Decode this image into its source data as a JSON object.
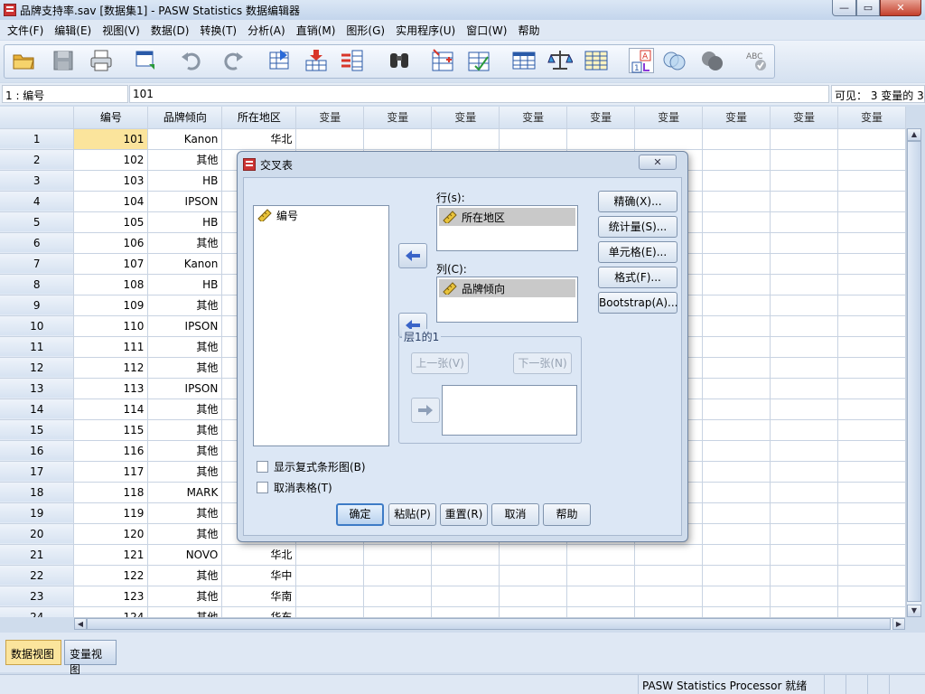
{
  "window": {
    "title": "品牌支持率.sav [数据集1] - PASW Statistics 数据编辑器",
    "min": "—",
    "max": "▭",
    "close": "✕"
  },
  "menu": [
    "文件(F)",
    "编辑(E)",
    "视图(V)",
    "数据(D)",
    "转换(T)",
    "分析(A)",
    "直销(M)",
    "图形(G)",
    "实用程序(U)",
    "窗口(W)",
    "帮助"
  ],
  "toolbar": {
    "icons": [
      "open-folder-icon",
      "save-icon",
      "print-icon",
      "dialog-recall-icon",
      "undo-icon",
      "redo-icon",
      "goto-case-icon",
      "goto-variable-icon",
      "variables-icon",
      "find-icon",
      "insert-cases-icon",
      "insert-variable-icon",
      "split-file-icon",
      "weight-cases-icon",
      "select-cases-icon",
      "value-labels-icon",
      "use-sets-icon",
      "show-all-variables-icon",
      "spell-check-icon"
    ]
  },
  "cell_editor": {
    "ref": "1 : 编号",
    "value": "101",
    "visible": "可见：  3 变量的 3"
  },
  "grid": {
    "columns": [
      "编号",
      "品牌倾向",
      "所在地区",
      "变量",
      "变量",
      "变量",
      "变量",
      "变量",
      "变量",
      "变量",
      "变量",
      "变量"
    ],
    "rows": [
      {
        "n": "1",
        "id": "101",
        "brand": "Kanon",
        "region": "华北"
      },
      {
        "n": "2",
        "id": "102",
        "brand": "其他",
        "region": ""
      },
      {
        "n": "3",
        "id": "103",
        "brand": "HB",
        "region": ""
      },
      {
        "n": "4",
        "id": "104",
        "brand": "IPSON",
        "region": ""
      },
      {
        "n": "5",
        "id": "105",
        "brand": "HB",
        "region": ""
      },
      {
        "n": "6",
        "id": "106",
        "brand": "其他",
        "region": ""
      },
      {
        "n": "7",
        "id": "107",
        "brand": "Kanon",
        "region": ""
      },
      {
        "n": "8",
        "id": "108",
        "brand": "HB",
        "region": ""
      },
      {
        "n": "9",
        "id": "109",
        "brand": "其他",
        "region": ""
      },
      {
        "n": "10",
        "id": "110",
        "brand": "IPSON",
        "region": ""
      },
      {
        "n": "11",
        "id": "111",
        "brand": "其他",
        "region": ""
      },
      {
        "n": "12",
        "id": "112",
        "brand": "其他",
        "region": ""
      },
      {
        "n": "13",
        "id": "113",
        "brand": "IPSON",
        "region": ""
      },
      {
        "n": "14",
        "id": "114",
        "brand": "其他",
        "region": ""
      },
      {
        "n": "15",
        "id": "115",
        "brand": "其他",
        "region": ""
      },
      {
        "n": "16",
        "id": "116",
        "brand": "其他",
        "region": ""
      },
      {
        "n": "17",
        "id": "117",
        "brand": "其他",
        "region": ""
      },
      {
        "n": "18",
        "id": "118",
        "brand": "MARK",
        "region": ""
      },
      {
        "n": "19",
        "id": "119",
        "brand": "其他",
        "region": ""
      },
      {
        "n": "20",
        "id": "120",
        "brand": "其他",
        "region": ""
      },
      {
        "n": "21",
        "id": "121",
        "brand": "NOVO",
        "region": "华北"
      },
      {
        "n": "22",
        "id": "122",
        "brand": "其他",
        "region": "华中"
      },
      {
        "n": "23",
        "id": "123",
        "brand": "其他",
        "region": "华南"
      },
      {
        "n": "24",
        "id": "124",
        "brand": "其他",
        "region": "华东"
      }
    ]
  },
  "tabs": {
    "data_view": "数据视图",
    "variable_view": "变量视图"
  },
  "status": {
    "text": "PASW Statistics Processor 就绪"
  },
  "dialog": {
    "title": "交叉表",
    "close": "✕",
    "source_list": [
      "编号"
    ],
    "row_label": "行(s):",
    "row_items": [
      "所在地区"
    ],
    "col_label": "列(C):",
    "col_items": [
      "品牌倾向"
    ],
    "layer_label": "层1的1",
    "prev_layer": "上一张(V)",
    "next_layer": "下一张(N)",
    "side_buttons": [
      "精确(X)...",
      "统计量(S)...",
      "单元格(E)...",
      "格式(F)...",
      "Bootstrap(A)..."
    ],
    "checkboxes": [
      "显示复式条形图(B)",
      "取消表格(T)"
    ],
    "bottom_buttons": [
      "确定",
      "粘贴(P)",
      "重置(R)",
      "取消",
      "帮助"
    ]
  },
  "colors": {
    "selected_cell": "#fbe49c",
    "active_tab": "#fbe49c",
    "default_button_border": "#3d7bc6"
  }
}
